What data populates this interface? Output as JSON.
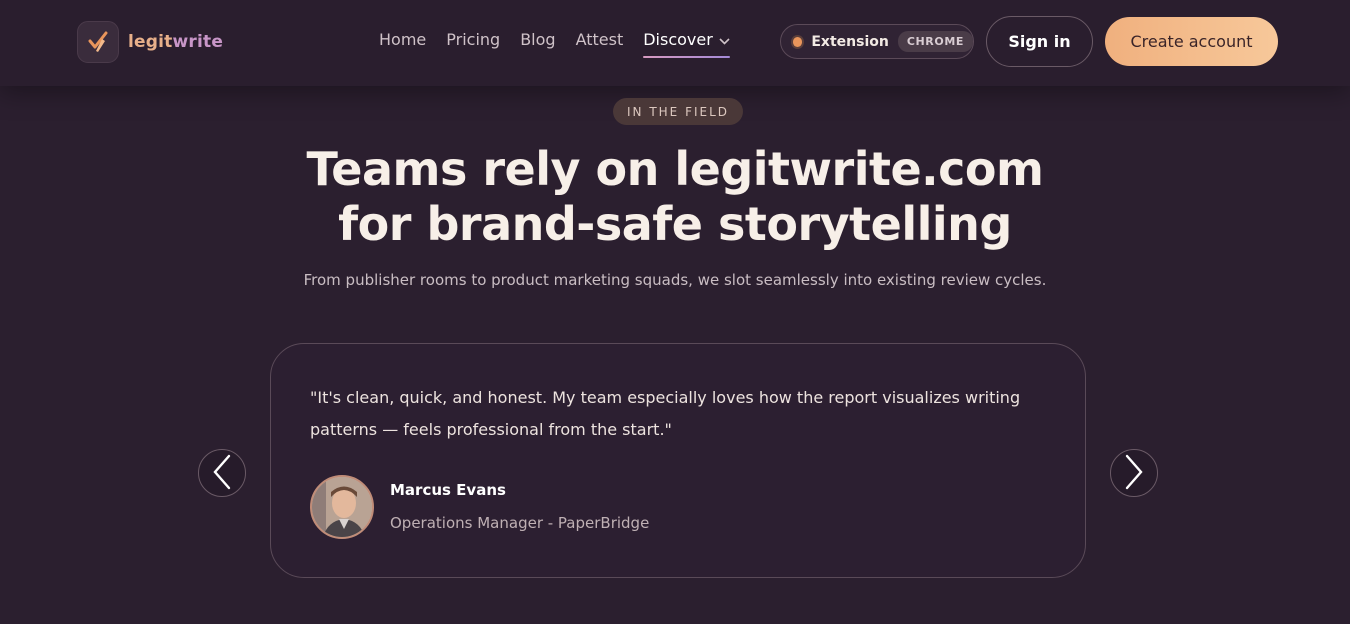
{
  "header": {
    "brand": {
      "part1": "legit",
      "part2": "write"
    },
    "nav": [
      "Home",
      "Pricing",
      "Blog",
      "Attest"
    ],
    "nav_active": "Discover",
    "extension": {
      "label": "Extension",
      "badge": "CHROME"
    },
    "signin_label": "Sign in",
    "create_label": "Create account"
  },
  "hero": {
    "badge": "IN THE FIELD",
    "title_line1": "Teams rely on legitwrite.com",
    "title_line2": "for brand-safe storytelling",
    "subtitle": "From publisher rooms to product marketing squads, we slot seamlessly into existing review cycles."
  },
  "testimonial": {
    "quote_line1": "\"It's clean, quick, and honest. My team especially loves how the report visualizes writing",
    "quote_line2": "patterns — feels professional from the start.\"",
    "name": "Marcus Evans",
    "role": "Operations Manager - PaperBridge"
  },
  "colors": {
    "background": "#2b1f2f",
    "accent": "#f0b07e",
    "brand_purple": "#c896c8"
  }
}
